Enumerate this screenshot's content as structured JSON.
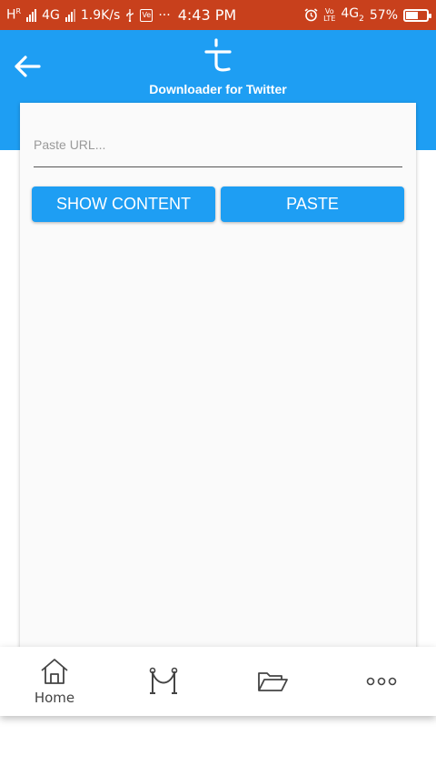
{
  "status_bar": {
    "network_left": "H",
    "network_roaming": "R",
    "network_4g": "4G",
    "speed": "1.9K/s",
    "vendor_icon_text": "Ve",
    "dots": "···",
    "time": "4:43 PM",
    "volte_top": "Vo",
    "volte_bottom": "LTE",
    "network_right": "4G",
    "network_right_sub": "2",
    "battery_percent": "57%",
    "battery_level": 0.57
  },
  "app_bar": {
    "title": "Downloader for Twitter",
    "back_icon": "arrow-left-icon",
    "logo_icon": "t-logo-icon"
  },
  "form": {
    "url_placeholder": "Paste URL...",
    "url_value": "",
    "show_content_label": "SHOW CONTENT",
    "paste_label": "PASTE"
  },
  "bottom_nav": {
    "items": [
      {
        "label": "Home",
        "icon": "home-icon"
      },
      {
        "label": "",
        "icon": "gallery-icon"
      },
      {
        "label": "",
        "icon": "folder-icon"
      },
      {
        "label": "",
        "icon": "more-icon"
      }
    ]
  },
  "colors": {
    "status_bar": "#c8401c",
    "primary": "#1e9ef3",
    "card": "#fafafa"
  }
}
